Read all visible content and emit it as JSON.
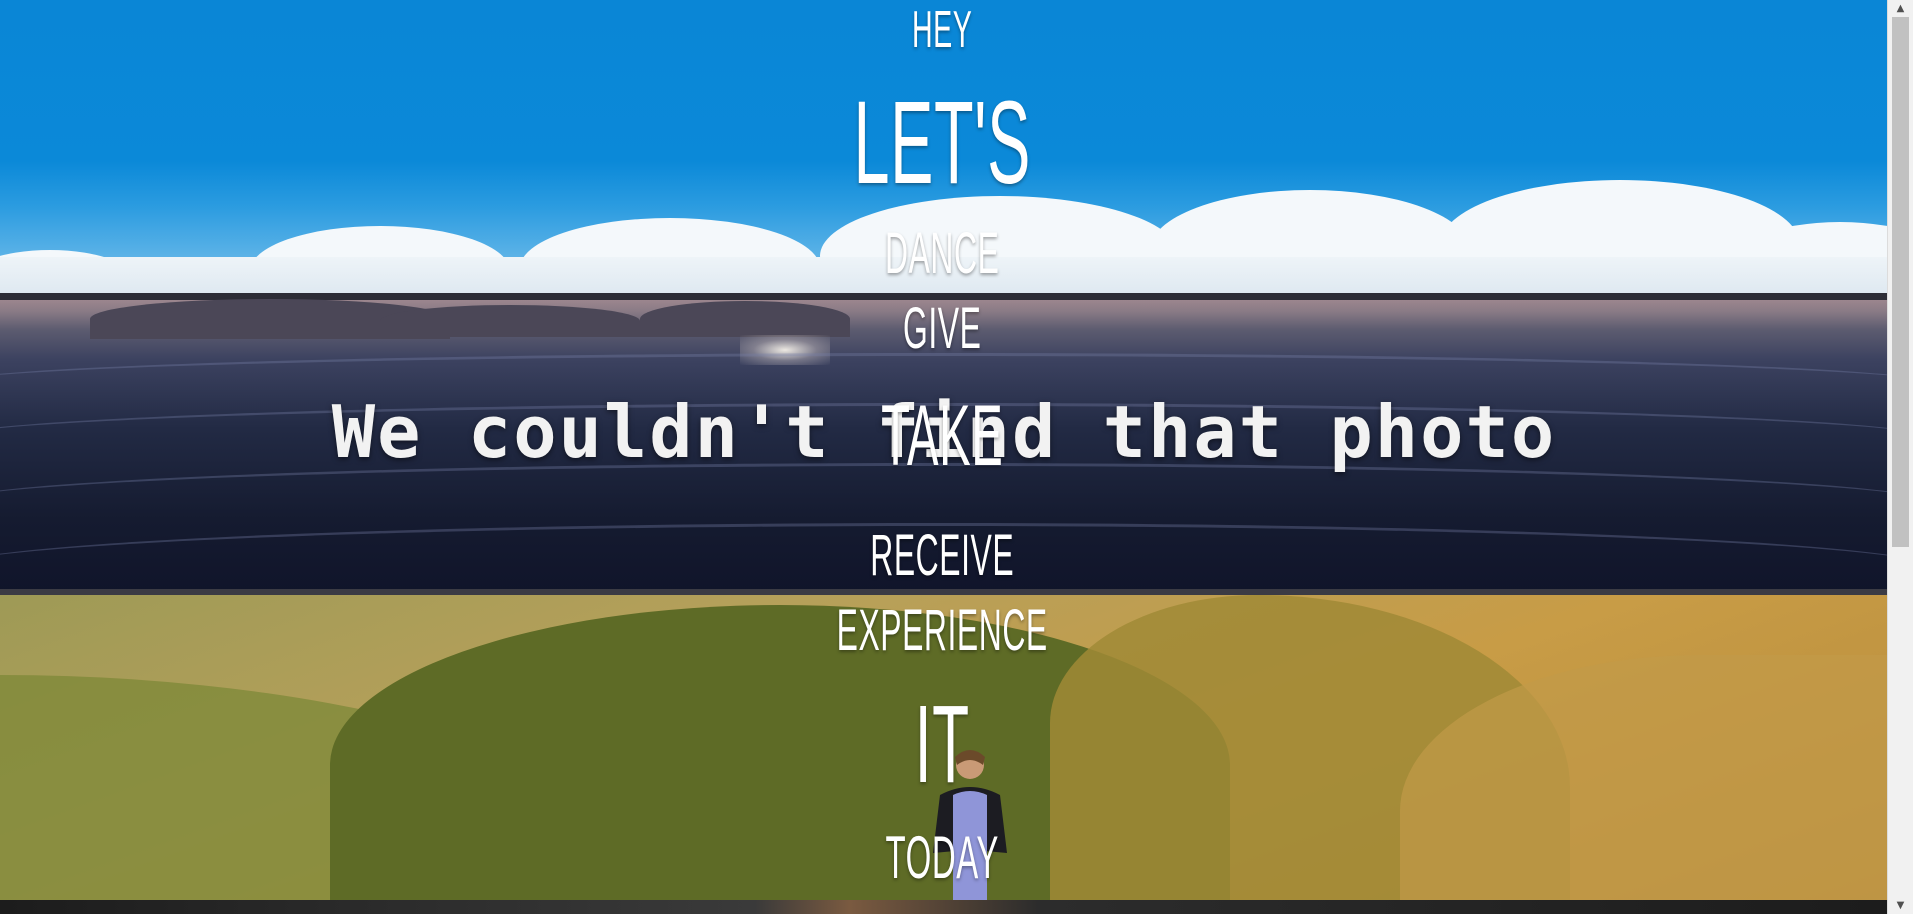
{
  "words": {
    "hey": "HEY",
    "lets": "LET'S",
    "dance": "DANCE",
    "give": "GIVE",
    "take": "TAKE",
    "receive": "RECEIVE",
    "experience": "EXPERIENCE",
    "it": "IT",
    "today": "TODAY"
  },
  "ocean_panel": {
    "error_message": "We couldn't find that photo"
  },
  "scrollbar": {
    "up_icon": "triangle-up-icon",
    "down_icon": "triangle-down-icon",
    "up_glyph": "▲",
    "down_glyph": "▼"
  },
  "colors": {
    "sky": "#0a86d6",
    "ocean": "#1a2038",
    "mountain": "#b69a4e",
    "text": "#ffffff"
  }
}
